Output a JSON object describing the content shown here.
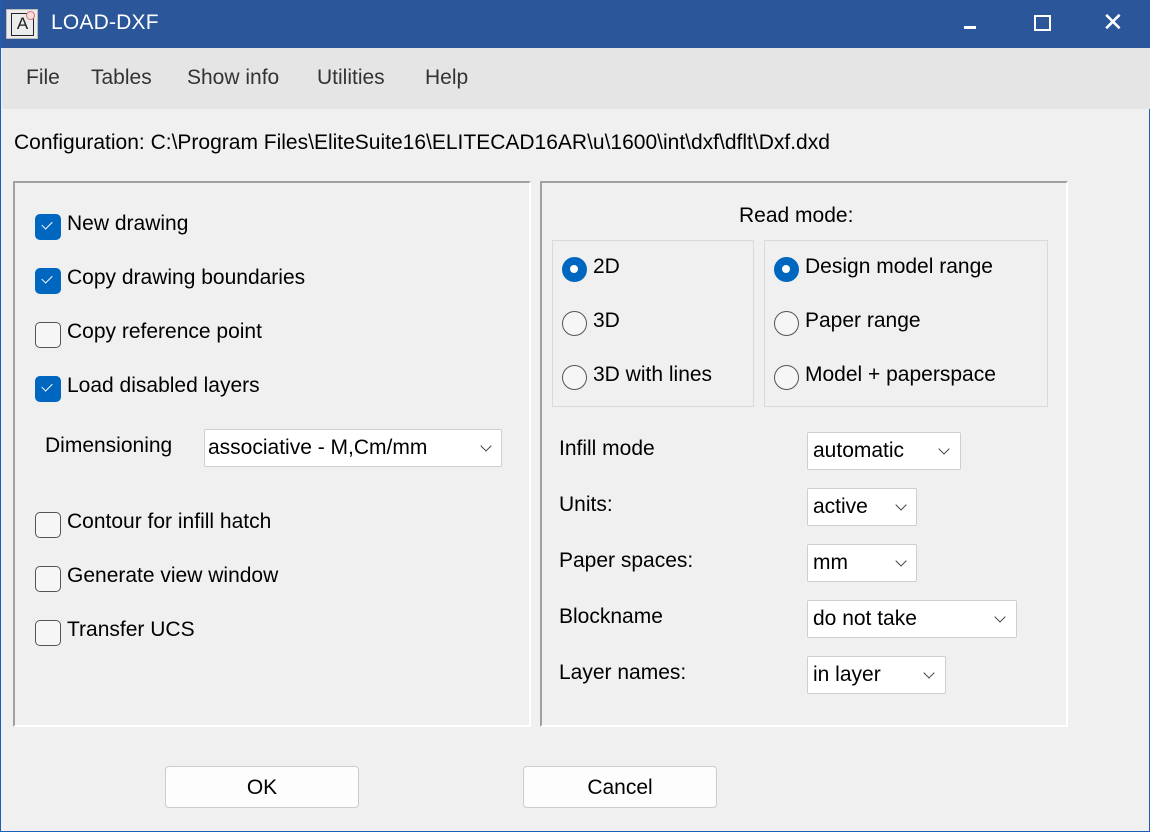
{
  "window": {
    "title": "LOAD-DXF",
    "app_icon_letter": "A",
    "controls": {
      "minimize": "minimize-icon",
      "maximize": "maximize-icon",
      "close": "close-icon",
      "close_glyph": "✕"
    }
  },
  "menu": [
    "File",
    "Tables",
    "Show info",
    "Utilities",
    "Help"
  ],
  "configuration": "Configuration:  C:\\Program Files\\EliteSuite16\\ELITECAD16AR\\u\\1600\\int\\dxf\\dflt\\Dxf.dxd",
  "left_panel": {
    "options_top": [
      {
        "label": "New drawing",
        "checked": true
      },
      {
        "label": "Copy drawing boundaries",
        "checked": true
      },
      {
        "label": "Copy reference point",
        "checked": false
      },
      {
        "label": "Load disabled layers",
        "checked": true
      }
    ],
    "dimensioning": {
      "label": "Dimensioning",
      "value": "associative - M,Cm/mm"
    },
    "options_bottom": [
      {
        "label": "Contour for infill hatch",
        "checked": false
      },
      {
        "label": "Generate view window",
        "checked": false
      },
      {
        "label": "Transfer UCS",
        "checked": false
      }
    ]
  },
  "right_panel": {
    "read_mode_title": "Read mode:",
    "dimension_mode": [
      {
        "label": "2D",
        "selected": true
      },
      {
        "label": "3D",
        "selected": false
      },
      {
        "label": "3D with lines",
        "selected": false
      }
    ],
    "range_mode": [
      {
        "label": "Design model range",
        "selected": true
      },
      {
        "label": "Paper range",
        "selected": false
      },
      {
        "label": "Model + paperspace",
        "selected": false
      }
    ],
    "fields": [
      {
        "label": "Infill mode",
        "value": "automatic"
      },
      {
        "label": "Units:",
        "value": "active"
      },
      {
        "label": "Paper spaces:",
        "value": "mm"
      },
      {
        "label": "Blockname",
        "value": "do not take"
      },
      {
        "label": "Layer names:",
        "value": "in layer"
      }
    ]
  },
  "buttons": {
    "ok": "OK",
    "cancel": "Cancel"
  },
  "colors": {
    "titlebar": "#2b579a",
    "accent": "#0067c0",
    "menubar": "#e5e5e5",
    "background": "#f0f0f0"
  }
}
